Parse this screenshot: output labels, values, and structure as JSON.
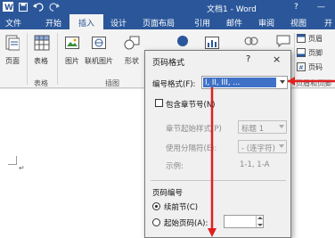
{
  "titlebar": {
    "doc_title": "文档1 - Word",
    "help": "?",
    "minimize": "—",
    "save_icon": "save-icon",
    "undo_icon": "undo-icon",
    "redo_icon": "redo-icon"
  },
  "tabs": {
    "file": "文件",
    "items": [
      "开始",
      "插入",
      "设计",
      "页面布局",
      "引用",
      "邮件",
      "审阅",
      "视图",
      "开"
    ]
  },
  "ribbon": {
    "pages_label": "页面",
    "table_label": "表格",
    "picture_label": "图片",
    "online_picture_label": "联机图片",
    "shapes_label": "形状",
    "header_label": "页眉",
    "footer_label": "页脚",
    "page_number_label": "页码",
    "group_tables": "表格",
    "group_illustrations": "插图",
    "group_header_footer": "页眉和页脚"
  },
  "dialog": {
    "title": "页码格式",
    "help": "?",
    "close": "×",
    "number_format_label": "编号格式(F):",
    "number_format_value": "I, II, III, ...",
    "include_chapter_label": "包含章节号(N)",
    "chapter_style_label": "章节起始样式(P)",
    "chapter_style_value": "标题 1",
    "separator_label": "使用分隔符(E):",
    "separator_value": "- (连字符)",
    "example_label": "示例:",
    "example_value": "1-1, 1-A",
    "page_numbering_label": "页码编号",
    "continue_label": "续前节(C)",
    "start_at_label": "起始页码(A):"
  },
  "colors": {
    "word_blue": "#2b579a",
    "annotation_red": "#e02020"
  }
}
